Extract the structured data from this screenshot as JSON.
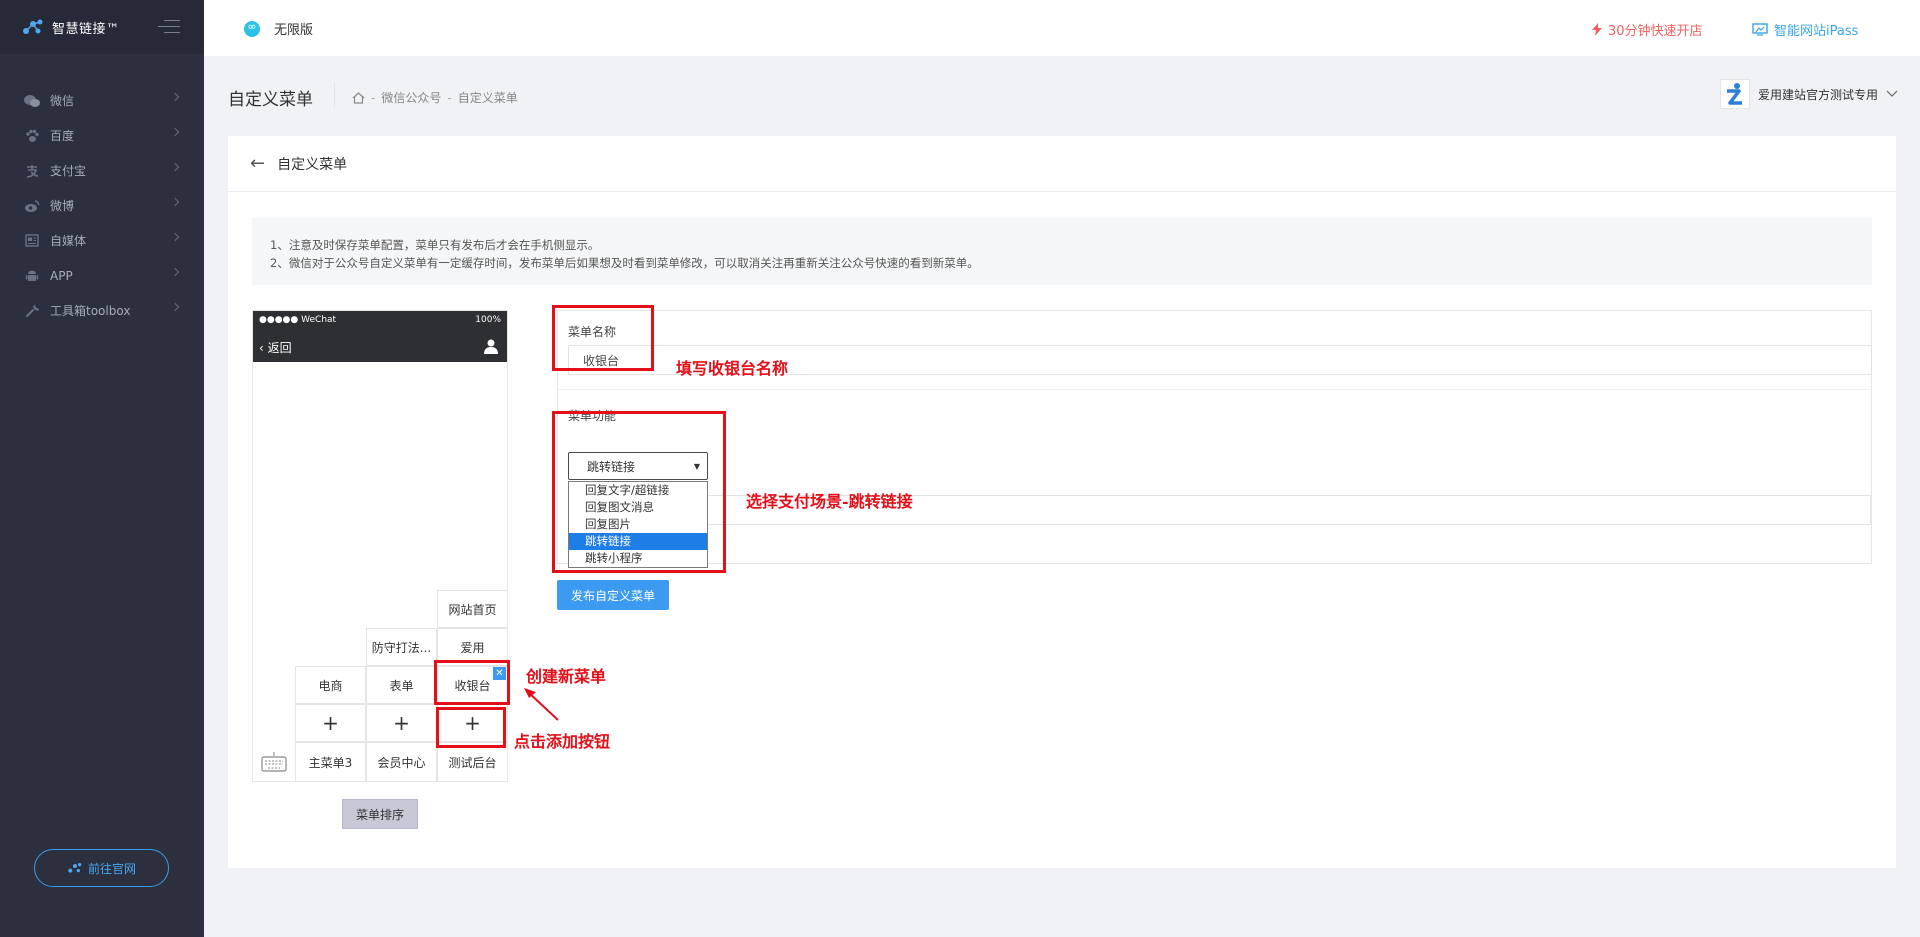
{
  "sidebar": {
    "logo_text": "智慧链接™",
    "items": [
      {
        "label": "微信",
        "icon": "wechat-icon"
      },
      {
        "label": "百度",
        "icon": "paw-icon"
      },
      {
        "label": "支付宝",
        "icon": "alipay-icon"
      },
      {
        "label": "微博",
        "icon": "weibo-icon"
      },
      {
        "label": "自媒体",
        "icon": "media-icon"
      },
      {
        "label": "APP",
        "icon": "android-icon"
      },
      {
        "label": "工具箱toolbox",
        "icon": "wrench-icon"
      }
    ],
    "goto_label": "前往官网"
  },
  "topbar": {
    "edition": "无限版",
    "quick_open": "30分钟快速开店",
    "ipass": "智能网站iPass"
  },
  "pagehead": {
    "title": "自定义菜单",
    "breadcrumb": [
      "微信公众号",
      "自定义菜单"
    ],
    "account": "爱用建站官方测试专用"
  },
  "card": {
    "title": "自定义菜单",
    "notice": [
      "1、注意及时保存菜单配置，菜单只有发布后才会在手机侧显示。",
      "2、微信对于公众号自定义菜单有一定缓存时间，发布菜单后如果想及时看到菜单修改，可以取消关注再重新关注公众号快速的看到新菜单。"
    ]
  },
  "phone": {
    "carrier": "●●●●● WeChat",
    "battery": "100%",
    "back": "返回",
    "col3_sub": [
      "网站首页",
      "爱用",
      "收银台"
    ],
    "col2_sub": [
      "防守打法...",
      "表单"
    ],
    "col1_sub": [
      "电商"
    ],
    "plus": "+",
    "main_menus": [
      "主菜单3",
      "会员中心",
      "测试后台"
    ],
    "close": "✕"
  },
  "form": {
    "name_label": "菜单名称",
    "name_value": "收银台",
    "func_label": "菜单功能",
    "selected": "跳转链接",
    "options": [
      "回复文字/超链接",
      "回复图文消息",
      "回复图片",
      "跳转链接",
      "跳转小程序"
    ],
    "publish": "发布自定义菜单",
    "sort": "菜单排序"
  },
  "annotations": {
    "name_hint": "填写收银台名称",
    "func_hint": "选择支付场景-跳转链接",
    "create_hint": "创建新菜单",
    "add_hint": "点击添加按钮"
  },
  "colors": {
    "accent": "#3c9af0",
    "annotation": "#e3101a",
    "sidebar": "#2b2f3e"
  }
}
